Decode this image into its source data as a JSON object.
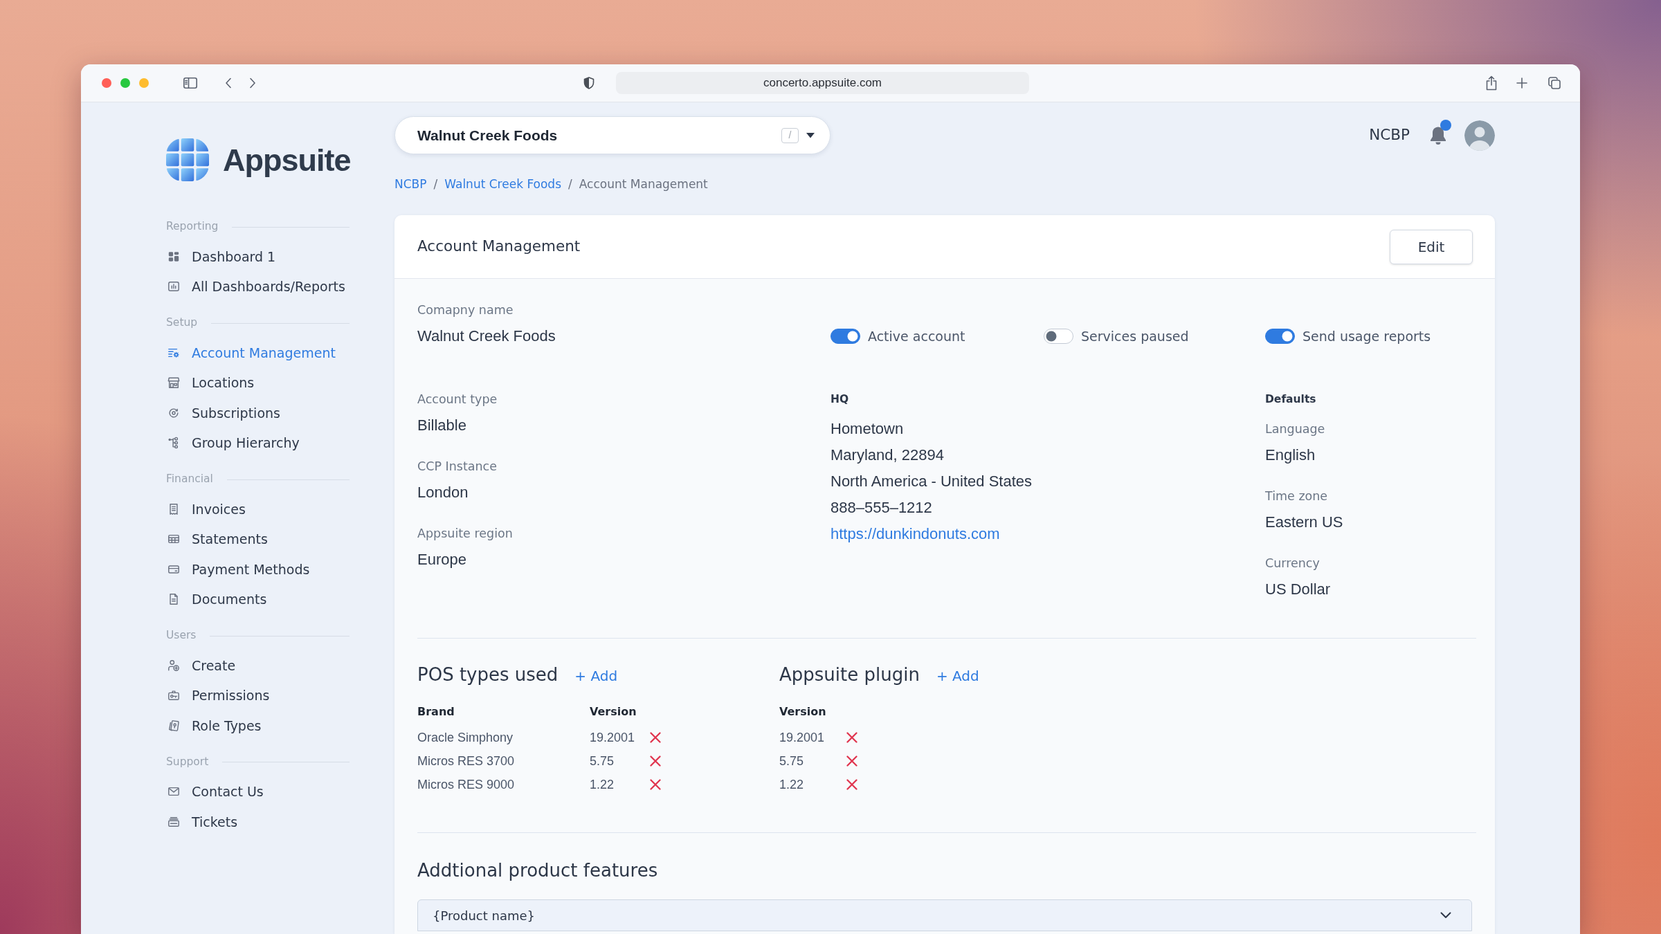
{
  "browser": {
    "url": "concerto.appsuite.com"
  },
  "brand": {
    "name": "Appsuite"
  },
  "sidebar": {
    "sections": [
      {
        "title": "Reporting",
        "items": [
          {
            "label": "Dashboard 1",
            "selected": false
          },
          {
            "label": "All Dashboards/Reports",
            "selected": false
          }
        ]
      },
      {
        "title": "Setup",
        "items": [
          {
            "label": "Account Management",
            "selected": true
          },
          {
            "label": "Locations",
            "selected": false
          },
          {
            "label": "Subscriptions",
            "selected": false
          },
          {
            "label": "Group Hierarchy",
            "selected": false
          }
        ]
      },
      {
        "title": "Financial",
        "items": [
          {
            "label": "Invoices",
            "selected": false
          },
          {
            "label": "Statements",
            "selected": false
          },
          {
            "label": "Payment Methods",
            "selected": false
          },
          {
            "label": "Documents",
            "selected": false
          }
        ]
      },
      {
        "title": "Users",
        "items": [
          {
            "label": "Create",
            "selected": false
          },
          {
            "label": "Permissions",
            "selected": false
          },
          {
            "label": "Role Types",
            "selected": false
          }
        ]
      },
      {
        "title": "Support",
        "items": [
          {
            "label": "Contact Us",
            "selected": false
          },
          {
            "label": "Tickets",
            "selected": false
          }
        ]
      }
    ]
  },
  "account_selector": {
    "value": "Walnut Creek Foods",
    "shortcut": "/"
  },
  "header": {
    "organization": "NCBP",
    "notifications": {
      "unread": true
    }
  },
  "breadcrumb": [
    {
      "kind": "link",
      "label": "NCBP"
    },
    {
      "kind": "separator",
      "label": "/"
    },
    {
      "kind": "link",
      "label": "Walnut Creek Foods"
    },
    {
      "kind": "separator",
      "label": "/"
    },
    {
      "kind": "current",
      "label": "Account Management"
    }
  ],
  "account": {
    "title": "Account Management",
    "edit_button": "Edit",
    "company_name": {
      "label": "Comapny name",
      "value": "Walnut Creek Foods"
    },
    "toggles": [
      {
        "label": "Active account",
        "on": true
      },
      {
        "label": "Services paused",
        "on": false
      },
      {
        "label": "Send usage reports",
        "on": true
      }
    ],
    "details": [
      {
        "label": "Account type",
        "value": "Billable"
      },
      {
        "label": "CCP Instance",
        "value": "London"
      },
      {
        "label": "Appsuite region",
        "value": "Europe"
      }
    ],
    "hq": {
      "title": "HQ",
      "address": [
        "Hometown",
        "Maryland, 22894",
        "North America - United States"
      ],
      "phone": "888–555–1212",
      "website": "https://dunkindonuts.com"
    },
    "defaults": {
      "title": "Defaults",
      "fields": [
        {
          "label": "Language",
          "value": "English"
        },
        {
          "label": "Time zone",
          "value": "Eastern US"
        },
        {
          "label": "Currency",
          "value": "US Dollar"
        }
      ]
    },
    "pos_types": {
      "title": "POS types used",
      "add_label": "+ Add",
      "columns": [
        "Brand",
        "Version"
      ],
      "rows": [
        [
          "Oracle Simphony",
          "19.2001"
        ],
        [
          "Micros RES 3700",
          "5.75"
        ],
        [
          "Micros RES 9000",
          "1.22"
        ]
      ]
    },
    "plugins": {
      "title": "Appsuite plugin",
      "add_label": "+ Add",
      "columns": [
        "Version"
      ],
      "rows": [
        [
          "19.2001"
        ],
        [
          "5.75"
        ],
        [
          "1.22"
        ]
      ]
    },
    "additional_features": {
      "title": "Addtional product features",
      "items": [
        {
          "label": "{Product name}"
        }
      ]
    }
  }
}
